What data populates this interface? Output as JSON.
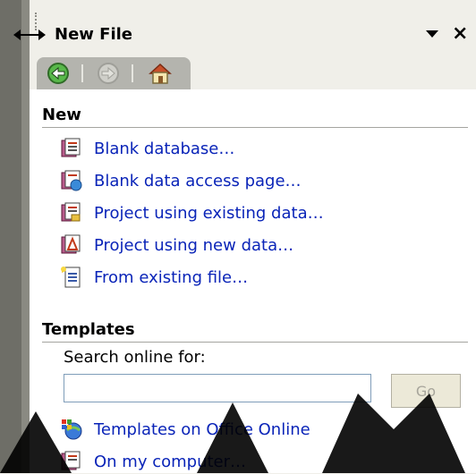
{
  "pane": {
    "title": "New File",
    "dropdown_icon": "dropdown-arrow-icon",
    "close_label": "×"
  },
  "nav": {
    "back_icon": "back-arrow-icon",
    "forward_icon": "forward-arrow-icon",
    "home_icon": "home-icon"
  },
  "new_section": {
    "title": "New",
    "items": [
      {
        "label": "Blank database…",
        "icon": "blank-database-icon"
      },
      {
        "label": "Blank data access page…",
        "icon": "data-access-page-icon"
      },
      {
        "label": "Project using existing data…",
        "icon": "project-existing-data-icon"
      },
      {
        "label": "Project using new data…",
        "icon": "project-new-data-icon"
      },
      {
        "label": "From existing file…",
        "icon": "existing-file-icon"
      }
    ]
  },
  "templates_section": {
    "title": "Templates",
    "search_label": "Search online for:",
    "search_value": "",
    "go_label": "Go",
    "items": [
      {
        "label": "Templates on Office Online",
        "icon": "office-online-icon"
      },
      {
        "label": "On my computer…",
        "icon": "computer-templates-icon"
      }
    ]
  },
  "colors": {
    "link": "#0a24b8",
    "pane_background": "#f0efe9",
    "navbar": "#b4b4ae",
    "back_button": "#58b84a"
  }
}
